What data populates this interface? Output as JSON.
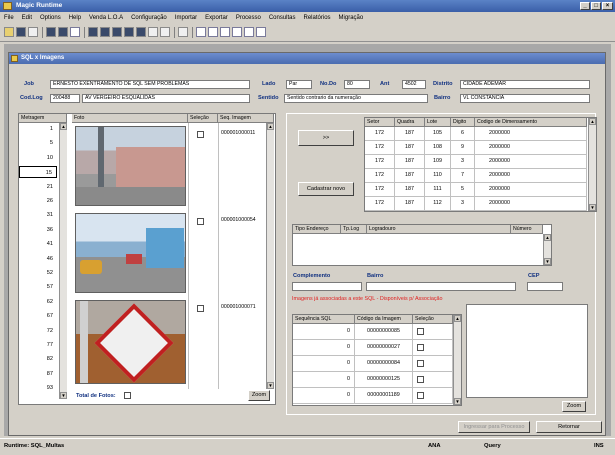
{
  "window": {
    "title": "Magic Runtime"
  },
  "menu": [
    "File",
    "Edit",
    "Options",
    "Help",
    "Venda L.O.A",
    "Configuração",
    "Importar",
    "Exportar",
    "Processo",
    "Consultas",
    "Relatórios",
    "Migração"
  ],
  "child_window": {
    "title": "SQL x Imagens"
  },
  "header": {
    "job_label": "Job",
    "job_value": "ERNESTO EXENTRAMENTO DE SQL SEM PROBLEMAS",
    "codlog_label": "Cod.Log",
    "codlog_value": "200488",
    "codlog_name": "AV VERGEIRO ESQUALIDAS",
    "lado_label": "Lado",
    "lado_value": "Par",
    "nodo_label": "No.Do",
    "nodo_value": "80",
    "ant_label": "Ant",
    "ant_value": "4502",
    "distrito_label": "Distrito",
    "distrito_value": "CIDADE ADEMAR",
    "sentido_label": "Sentido",
    "sentido_value": "Sentido contrario da numeração",
    "bairro_label": "Bairro",
    "bairro_value": "VL CONSTANCIA"
  },
  "metragem": {
    "header": "Metragem",
    "values": [
      "1",
      "5",
      "10",
      "15",
      "21",
      "26",
      "31",
      "36",
      "41",
      "46",
      "52",
      "57",
      "62",
      "67",
      "72",
      "77",
      "82",
      "87",
      "93"
    ]
  },
  "fotos": {
    "headers": [
      "Foto",
      "Seleção",
      "Seq. Imagem"
    ],
    "rows": [
      {
        "seq": "000001000011"
      },
      {
        "seq": "000001000054"
      },
      {
        "seq": "000001000071"
      }
    ]
  },
  "total_fotos_label": "Total de Fotos:",
  "buttons": {
    "move": ">>",
    "add_new": "Cadastrar novo",
    "zoom_left": "Zoom",
    "zoom_right": "Zoom",
    "prev": "Ingressar para Processo",
    "return": "Retornar"
  },
  "setor_table": {
    "headers": [
      "Setor",
      "Quadra",
      "Lote",
      "Digito",
      "Codigo de Dimensamento"
    ],
    "rows": [
      [
        "172",
        "187",
        "105",
        "6",
        "2000000"
      ],
      [
        "172",
        "187",
        "108",
        "9",
        "2000000"
      ],
      [
        "172",
        "187",
        "109",
        "3",
        "2000000"
      ],
      [
        "172",
        "187",
        "110",
        "7",
        "2000000"
      ],
      [
        "172",
        "187",
        "111",
        "5",
        "2000000"
      ],
      [
        "172",
        "187",
        "112",
        "3",
        "2000000"
      ]
    ]
  },
  "endereco_table": {
    "headers": [
      "Tipo Endereço",
      "Tp.Log",
      "Logradouro",
      "Número"
    ]
  },
  "complemento": {
    "label": "Complemento",
    "bairro_label": "Bairro",
    "cep_label": "CEP"
  },
  "imagens_note": "Imagens já associadas a este SQL - Disponíveis p/ Associação",
  "seq_table": {
    "headers": [
      "Sequência SQL",
      "Código da Imagem",
      "Seleção"
    ],
    "rows": [
      [
        "0",
        "00000000085"
      ],
      [
        "0",
        "00000000027"
      ],
      [
        "0",
        "00000000084"
      ],
      [
        "0",
        "00000000125"
      ],
      [
        "0",
        "00000001189"
      ]
    ]
  },
  "status": {
    "program": "Runtime: SQL_Multas",
    "mode": "ANA",
    "query": "Query",
    "ins": "INS"
  },
  "colors": {
    "title_gradient_top": "#5a82c6",
    "label_blue": "#103080",
    "note_red": "#e02020"
  }
}
